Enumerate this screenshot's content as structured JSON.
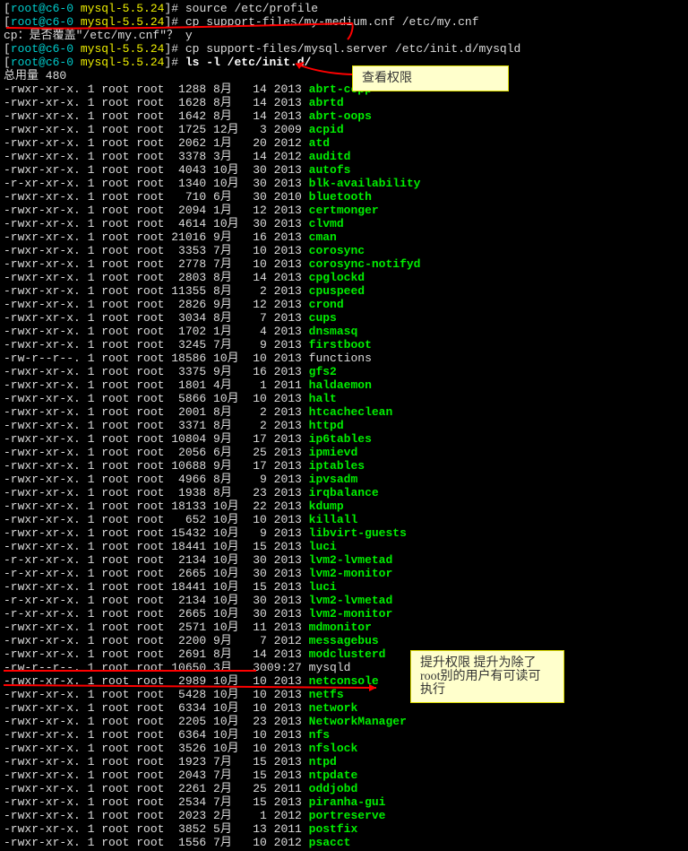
{
  "prompt": {
    "user": "root",
    "host": "c6-0",
    "dir": "mysql-5.5.24",
    "sep_open": "[",
    "sep_close": "]#"
  },
  "cmds": {
    "c1": "source /etc/profile",
    "c2": "cp support-files/my-medium.cnf /etc/my.cnf",
    "cp_prompt": "cp：是否覆盖\"/etc/my.cnf\"？ y",
    "c3": "cp support-files/mysql.server /etc/init.d/mysqld",
    "c4": "ls -l /etc/init.d/",
    "total": "总用量 480"
  },
  "cols": [
    "perm",
    "n",
    "own",
    "grp",
    "size",
    "month",
    "day",
    "year",
    "name"
  ],
  "files": [
    {
      "perm": "-rwxr-xr-x.",
      "n": "1",
      "own": "root",
      "grp": "root",
      "size": "1288",
      "month": "8月",
      "day": "14",
      "year": "2013",
      "name": "abrt-ccpp"
    },
    {
      "perm": "-rwxr-xr-x.",
      "n": "1",
      "own": "root",
      "grp": "root",
      "size": "1628",
      "month": "8月",
      "day": "14",
      "year": "2013",
      "name": "abrtd"
    },
    {
      "perm": "-rwxr-xr-x.",
      "n": "1",
      "own": "root",
      "grp": "root",
      "size": "1642",
      "month": "8月",
      "day": "14",
      "year": "2013",
      "name": "abrt-oops"
    },
    {
      "perm": "-rwxr-xr-x.",
      "n": "1",
      "own": "root",
      "grp": "root",
      "size": "1725",
      "month": "12月",
      "day": "3",
      "year": "2009",
      "name": "acpid"
    },
    {
      "perm": "-rwxr-xr-x.",
      "n": "1",
      "own": "root",
      "grp": "root",
      "size": "2062",
      "month": "1月",
      "day": "20",
      "year": "2012",
      "name": "atd"
    },
    {
      "perm": "-rwxr-xr-x.",
      "n": "1",
      "own": "root",
      "grp": "root",
      "size": "3378",
      "month": "3月",
      "day": "14",
      "year": "2012",
      "name": "auditd"
    },
    {
      "perm": "-rwxr-xr-x.",
      "n": "1",
      "own": "root",
      "grp": "root",
      "size": "4043",
      "month": "10月",
      "day": "30",
      "year": "2013",
      "name": "autofs"
    },
    {
      "perm": "-r-xr-xr-x.",
      "n": "1",
      "own": "root",
      "grp": "root",
      "size": "1340",
      "month": "10月",
      "day": "30",
      "year": "2013",
      "name": "blk-availability"
    },
    {
      "perm": "-rwxr-xr-x.",
      "n": "1",
      "own": "root",
      "grp": "root",
      "size": "710",
      "month": "6月",
      "day": "30",
      "year": "2010",
      "name": "bluetooth"
    },
    {
      "perm": "-rwxr-xr-x.",
      "n": "1",
      "own": "root",
      "grp": "root",
      "size": "2094",
      "month": "1月",
      "day": "12",
      "year": "2013",
      "name": "certmonger"
    },
    {
      "perm": "-rwxr-xr-x.",
      "n": "1",
      "own": "root",
      "grp": "root",
      "size": "4614",
      "month": "10月",
      "day": "30",
      "year": "2013",
      "name": "clvmd"
    },
    {
      "perm": "-rwxr-xr-x.",
      "n": "1",
      "own": "root",
      "grp": "root",
      "size": "21016",
      "month": "9月",
      "day": "16",
      "year": "2013",
      "name": "cman"
    },
    {
      "perm": "-rwxr-xr-x.",
      "n": "1",
      "own": "root",
      "grp": "root",
      "size": "3353",
      "month": "7月",
      "day": "10",
      "year": "2013",
      "name": "corosync"
    },
    {
      "perm": "-rwxr-xr-x.",
      "n": "1",
      "own": "root",
      "grp": "root",
      "size": "2778",
      "month": "7月",
      "day": "10",
      "year": "2013",
      "name": "corosync-notifyd"
    },
    {
      "perm": "-rwxr-xr-x.",
      "n": "1",
      "own": "root",
      "grp": "root",
      "size": "2803",
      "month": "8月",
      "day": "14",
      "year": "2013",
      "name": "cpglockd"
    },
    {
      "perm": "-rwxr-xr-x.",
      "n": "1",
      "own": "root",
      "grp": "root",
      "size": "11355",
      "month": "8月",
      "day": "2",
      "year": "2013",
      "name": "cpuspeed"
    },
    {
      "perm": "-rwxr-xr-x.",
      "n": "1",
      "own": "root",
      "grp": "root",
      "size": "2826",
      "month": "9月",
      "day": "12",
      "year": "2013",
      "name": "crond"
    },
    {
      "perm": "-rwxr-xr-x.",
      "n": "1",
      "own": "root",
      "grp": "root",
      "size": "3034",
      "month": "8月",
      "day": "7",
      "year": "2013",
      "name": "cups"
    },
    {
      "perm": "-rwxr-xr-x.",
      "n": "1",
      "own": "root",
      "grp": "root",
      "size": "1702",
      "month": "1月",
      "day": "4",
      "year": "2013",
      "name": "dnsmasq"
    },
    {
      "perm": "-rwxr-xr-x.",
      "n": "1",
      "own": "root",
      "grp": "root",
      "size": "3245",
      "month": "7月",
      "day": "9",
      "year": "2013",
      "name": "firstboot"
    },
    {
      "perm": "-rw-r--r--.",
      "n": "1",
      "own": "root",
      "grp": "root",
      "size": "18586",
      "month": "10月",
      "day": "10",
      "year": "2013",
      "name": "functions",
      "plain": true
    },
    {
      "perm": "-rwxr-xr-x.",
      "n": "1",
      "own": "root",
      "grp": "root",
      "size": "3375",
      "month": "9月",
      "day": "16",
      "year": "2013",
      "name": "gfs2"
    },
    {
      "perm": "-rwxr-xr-x.",
      "n": "1",
      "own": "root",
      "grp": "root",
      "size": "1801",
      "month": "4月",
      "day": "1",
      "year": "2011",
      "name": "haldaemon"
    },
    {
      "perm": "-rwxr-xr-x.",
      "n": "1",
      "own": "root",
      "grp": "root",
      "size": "5866",
      "month": "10月",
      "day": "10",
      "year": "2013",
      "name": "halt"
    },
    {
      "perm": "-rwxr-xr-x.",
      "n": "1",
      "own": "root",
      "grp": "root",
      "size": "2001",
      "month": "8月",
      "day": "2",
      "year": "2013",
      "name": "htcacheclean"
    },
    {
      "perm": "-rwxr-xr-x.",
      "n": "1",
      "own": "root",
      "grp": "root",
      "size": "3371",
      "month": "8月",
      "day": "2",
      "year": "2013",
      "name": "httpd"
    },
    {
      "perm": "-rwxr-xr-x.",
      "n": "1",
      "own": "root",
      "grp": "root",
      "size": "10804",
      "month": "9月",
      "day": "17",
      "year": "2013",
      "name": "ip6tables"
    },
    {
      "perm": "-rwxr-xr-x.",
      "n": "1",
      "own": "root",
      "grp": "root",
      "size": "2056",
      "month": "6月",
      "day": "25",
      "year": "2013",
      "name": "ipmievd"
    },
    {
      "perm": "-rwxr-xr-x.",
      "n": "1",
      "own": "root",
      "grp": "root",
      "size": "10688",
      "month": "9月",
      "day": "17",
      "year": "2013",
      "name": "iptables"
    },
    {
      "perm": "-rwxr-xr-x.",
      "n": "1",
      "own": "root",
      "grp": "root",
      "size": "4966",
      "month": "8月",
      "day": "9",
      "year": "2013",
      "name": "ipvsadm"
    },
    {
      "perm": "-rwxr-xr-x.",
      "n": "1",
      "own": "root",
      "grp": "root",
      "size": "1938",
      "month": "8月",
      "day": "23",
      "year": "2013",
      "name": "irqbalance"
    },
    {
      "perm": "-rwxr-xr-x.",
      "n": "1",
      "own": "root",
      "grp": "root",
      "size": "18133",
      "month": "10月",
      "day": "22",
      "year": "2013",
      "name": "kdump"
    },
    {
      "perm": "-rwxr-xr-x.",
      "n": "1",
      "own": "root",
      "grp": "root",
      "size": "652",
      "month": "10月",
      "day": "10",
      "year": "2013",
      "name": "killall"
    },
    {
      "perm": "-rwxr-xr-x.",
      "n": "1",
      "own": "root",
      "grp": "root",
      "size": "15432",
      "month": "10月",
      "day": "9",
      "year": "2013",
      "name": "libvirt-guests"
    },
    {
      "perm": "-rwxr-xr-x.",
      "n": "1",
      "own": "root",
      "grp": "root",
      "size": "18441",
      "month": "10月",
      "day": "15",
      "year": "2013",
      "name": "luci"
    },
    {
      "perm": "-r-xr-xr-x.",
      "n": "1",
      "own": "root",
      "grp": "root",
      "size": "2134",
      "month": "10月",
      "day": "30",
      "year": "2013",
      "name": "lvm2-lvmetad"
    },
    {
      "perm": "-r-xr-xr-x.",
      "n": "1",
      "own": "root",
      "grp": "root",
      "size": "2665",
      "month": "10月",
      "day": "30",
      "year": "2013",
      "name": "lvm2-monitor"
    },
    {
      "perm": "-rwxr-xr-x.",
      "n": "1",
      "own": "root",
      "grp": "root",
      "size": "18441",
      "month": "10月",
      "day": "15",
      "year": "2013",
      "name": "luci"
    },
    {
      "perm": "-r-xr-xr-x.",
      "n": "1",
      "own": "root",
      "grp": "root",
      "size": "2134",
      "month": "10月",
      "day": "30",
      "year": "2013",
      "name": "lvm2-lvmetad"
    },
    {
      "perm": "-r-xr-xr-x.",
      "n": "1",
      "own": "root",
      "grp": "root",
      "size": "2665",
      "month": "10月",
      "day": "30",
      "year": "2013",
      "name": "lvm2-monitor"
    },
    {
      "perm": "-rwxr-xr-x.",
      "n": "1",
      "own": "root",
      "grp": "root",
      "size": "2571",
      "month": "10月",
      "day": "11",
      "year": "2013",
      "name": "mdmonitor"
    },
    {
      "perm": "-rwxr-xr-x.",
      "n": "1",
      "own": "root",
      "grp": "root",
      "size": "2200",
      "month": "9月",
      "day": "7",
      "year": "2012",
      "name": "messagebus"
    },
    {
      "perm": "-rwxr-xr-x.",
      "n": "1",
      "own": "root",
      "grp": "root",
      "size": "2691",
      "month": "8月",
      "day": "14",
      "year": "2013",
      "name": "modclusterd"
    },
    {
      "perm": "-rw-r--r--.",
      "n": "1",
      "own": "root",
      "grp": "root",
      "size": "10650",
      "month": "3月",
      "day": "30",
      "year": "09:27",
      "name": "mysqld",
      "plain": true
    },
    {
      "perm": "-rwxr-xr-x.",
      "n": "1",
      "own": "root",
      "grp": "root",
      "size": "2989",
      "month": "10月",
      "day": "10",
      "year": "2013",
      "name": "netconsole"
    },
    {
      "perm": "-rwxr-xr-x.",
      "n": "1",
      "own": "root",
      "grp": "root",
      "size": "5428",
      "month": "10月",
      "day": "10",
      "year": "2013",
      "name": "netfs"
    },
    {
      "perm": "-rwxr-xr-x.",
      "n": "1",
      "own": "root",
      "grp": "root",
      "size": "6334",
      "month": "10月",
      "day": "10",
      "year": "2013",
      "name": "network"
    },
    {
      "perm": "-rwxr-xr-x.",
      "n": "1",
      "own": "root",
      "grp": "root",
      "size": "2205",
      "month": "10月",
      "day": "23",
      "year": "2013",
      "name": "NetworkManager"
    },
    {
      "perm": "-rwxr-xr-x.",
      "n": "1",
      "own": "root",
      "grp": "root",
      "size": "6364",
      "month": "10月",
      "day": "10",
      "year": "2013",
      "name": "nfs"
    },
    {
      "perm": "-rwxr-xr-x.",
      "n": "1",
      "own": "root",
      "grp": "root",
      "size": "3526",
      "month": "10月",
      "day": "10",
      "year": "2013",
      "name": "nfslock"
    },
    {
      "perm": "-rwxr-xr-x.",
      "n": "1",
      "own": "root",
      "grp": "root",
      "size": "1923",
      "month": "7月",
      "day": "15",
      "year": "2013",
      "name": "ntpd"
    },
    {
      "perm": "-rwxr-xr-x.",
      "n": "1",
      "own": "root",
      "grp": "root",
      "size": "2043",
      "month": "7月",
      "day": "15",
      "year": "2013",
      "name": "ntpdate"
    },
    {
      "perm": "-rwxr-xr-x.",
      "n": "1",
      "own": "root",
      "grp": "root",
      "size": "2261",
      "month": "2月",
      "day": "25",
      "year": "2011",
      "name": "oddjobd"
    },
    {
      "perm": "-rwxr-xr-x.",
      "n": "1",
      "own": "root",
      "grp": "root",
      "size": "2534",
      "month": "7月",
      "day": "15",
      "year": "2013",
      "name": "piranha-gui"
    },
    {
      "perm": "-rwxr-xr-x.",
      "n": "1",
      "own": "root",
      "grp": "root",
      "size": "2023",
      "month": "2月",
      "day": "1",
      "year": "2012",
      "name": "portreserve"
    },
    {
      "perm": "-rwxr-xr-x.",
      "n": "1",
      "own": "root",
      "grp": "root",
      "size": "3852",
      "month": "5月",
      "day": "13",
      "year": "2011",
      "name": "postfix"
    },
    {
      "perm": "-rwxr-xr-x.",
      "n": "1",
      "own": "root",
      "grp": "root",
      "size": "1556",
      "month": "7月",
      "day": "10",
      "year": "2012",
      "name": "psacct"
    }
  ],
  "notes": {
    "n1": "查看权限",
    "n2": "提升权限 提升为除了\nroot别的用户有可读可\n执行"
  }
}
